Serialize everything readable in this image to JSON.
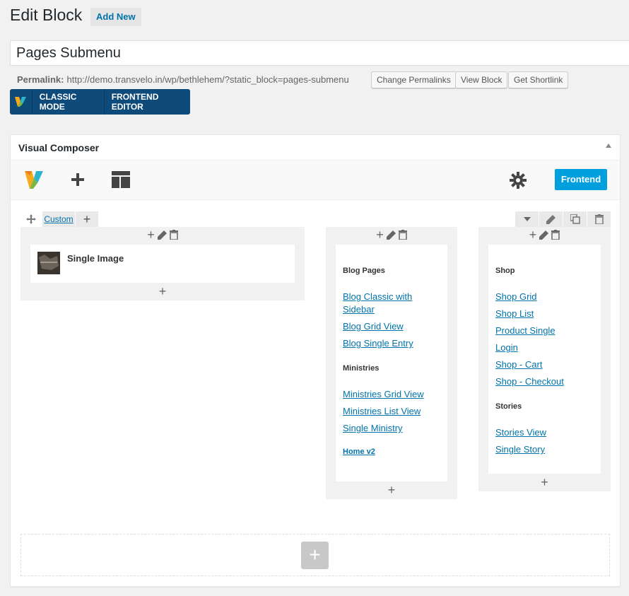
{
  "header": {
    "title": "Edit Block",
    "add_new": "Add New",
    "post_title": "Pages Submenu",
    "permalink_label": "Permalink:",
    "permalink_url": "http://demo.transvelo.in/wp/bethlehem/?static_block=pages-submenu",
    "buttons": {
      "change": "Change Permalinks",
      "view": "View Block",
      "shortlink": "Get Shortlink"
    }
  },
  "mode_switch": {
    "classic": "CLASSIC MODE",
    "frontend": "FRONTEND EDITOR"
  },
  "composer": {
    "title": "Visual Composer",
    "frontend_btn": "Frontend",
    "row": {
      "layout_label": "Custom"
    },
    "columns": [
      {
        "element": "Single Image"
      },
      {
        "groups": [
          {
            "title": "Blog Pages",
            "links": [
              "Blog Classic with Sidebar",
              "Blog Grid View",
              "Blog Single Entry"
            ]
          },
          {
            "title": "Ministries",
            "links": [
              "Ministries Grid View",
              "Ministries List View",
              "Single Ministry"
            ]
          }
        ],
        "extra_link": "Home v2"
      },
      {
        "groups": [
          {
            "title": "Shop",
            "links": [
              "Shop Grid",
              "Shop List",
              "Product Single",
              "Login",
              "Shop - Cart",
              "Shop - Checkout"
            ]
          },
          {
            "title": "Stories",
            "links": [
              "Stories View",
              "Single Story"
            ]
          }
        ]
      }
    ]
  },
  "colors": {
    "accent": "#0073aa",
    "vc_blue": "#0e4a7a",
    "frontend": "#00a0df"
  }
}
